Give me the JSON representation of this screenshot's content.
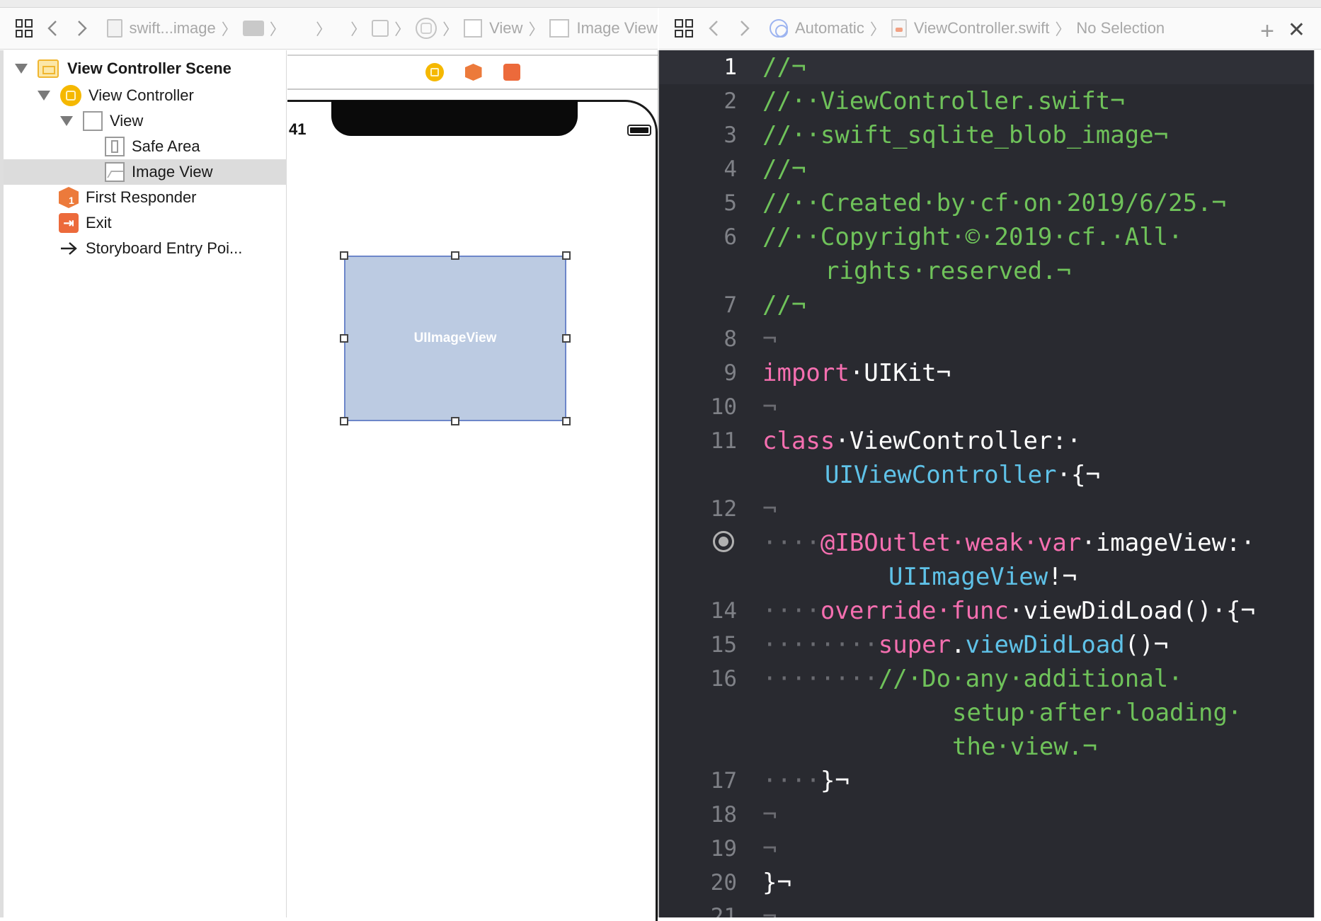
{
  "jumpbar_left": {
    "crumbs": [
      "swift...image",
      "View",
      "Image View"
    ]
  },
  "jumpbar_right": {
    "mode": "Automatic",
    "file": "ViewController.swift",
    "selection": "No Selection"
  },
  "outline": {
    "items": [
      {
        "label": "View Controller Scene",
        "icon": "scene-icon"
      },
      {
        "label": "View Controller",
        "icon": "view-controller-icon"
      },
      {
        "label": "View",
        "icon": "view-icon"
      },
      {
        "label": "Safe Area",
        "icon": "safe-area-icon"
      },
      {
        "label": "Image View",
        "icon": "image-view-icon",
        "selected": true
      },
      {
        "label": "First Responder",
        "icon": "first-responder-icon"
      },
      {
        "label": "Exit",
        "icon": "exit-icon"
      },
      {
        "label": "Storyboard Entry Poi...",
        "icon": "arrow-right-icon"
      }
    ]
  },
  "canvas": {
    "status_time": "41",
    "imageview_label": "UIImageView"
  },
  "editor": {
    "line_numbers": [
      "1",
      "2",
      "3",
      "4",
      "5",
      "6",
      "7",
      "8",
      "9",
      "10",
      "11",
      "12",
      "14",
      "15",
      "16",
      "17",
      "18",
      "19",
      "20",
      "21"
    ],
    "lines": {
      "l1": "//¬",
      "l2": "//··ViewController.swift¬",
      "l3": "//··swift_sqlite_blob_image¬",
      "l4": "//¬",
      "l5": "//··Created·by·cf·on·2019/6/25.¬",
      "l6a": "//··Copyright·©·2019·cf.·All·",
      "l6b": "rights·reserved.¬",
      "l7": "//¬",
      "l8": "¬",
      "l9_kw": "import",
      "l9_rest": "·UIKit¬",
      "l10": "¬",
      "l11_kw": "class",
      "l11_rest": "·ViewController:·",
      "l11b_ty": "UIViewController",
      "l11b_rest": "·{¬",
      "l12": "¬",
      "l13_dots": "····",
      "l13_kw": "@IBOutlet·weak·var",
      "l13_rest": "·imageView:·",
      "l13b_ty": "UIImageView",
      "l13b_rest": "!¬",
      "l14_dots": "····",
      "l14_kw": "override·func",
      "l14_rest": "·viewDidLoad()·{¬",
      "l15_dots": "········",
      "l15_kw": "super",
      "l15_dot": ".",
      "l15_ty": "viewDidLoad",
      "l15_rest": "()¬",
      "l16_dots": "········",
      "l16a": "//·Do·any·additional·",
      "l16b": "setup·after·loading·",
      "l16c": "the·view.¬",
      "l17_dots": "····",
      "l17_rest": "}¬",
      "l18": "¬",
      "l19": "¬",
      "l20": "}¬",
      "l21": "¬"
    }
  },
  "colors": {
    "editor_bg": "#292a30",
    "comment": "#6fc25a",
    "keyword": "#f56fb0",
    "type": "#5fc2e8",
    "imageview_fill": "#bccbe2"
  }
}
